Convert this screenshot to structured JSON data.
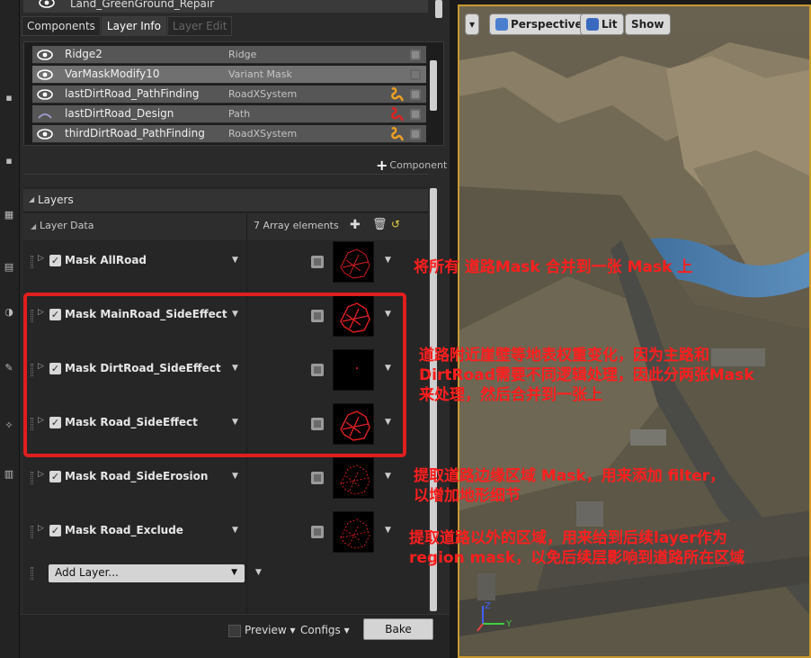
{
  "top_row": {
    "name": "Land_GreenGround_Repair"
  },
  "tabs": [
    {
      "label": "Components"
    },
    {
      "label": "Layer Info"
    },
    {
      "label": "Layer Edit"
    }
  ],
  "components": [
    {
      "name": "Ridge2",
      "type": "Ridge",
      "icon": "eye-icon"
    },
    {
      "name": "VarMaskModify10",
      "type": "Variant Mask",
      "icon": "eye-icon"
    },
    {
      "name": "lastDirtRoad_PathFinding",
      "type": "RoadXSystem",
      "icon": "eye-icon",
      "badge_color": "#f0a020"
    },
    {
      "name": "lastDirtRoad_Design",
      "type": "Path",
      "icon": "path-icon",
      "badge_color": "#e02020"
    },
    {
      "name": "thirdDirtRoad_PathFinding",
      "type": "RoadXSystem",
      "icon": "eye-icon",
      "badge_color": "#f0a020"
    }
  ],
  "add_component_label": "Component",
  "layers": {
    "section_title": "Layers",
    "subheader": "Layer Data",
    "count": "7 Array elements",
    "rows": [
      {
        "name": "Mask AllRoad"
      },
      {
        "name": "Mask MainRoad_SideEffect"
      },
      {
        "name": "Mask DirtRoad_SideEffect"
      },
      {
        "name": "Mask Road_SideEffect"
      },
      {
        "name": "Mask Road_SideErosion"
      },
      {
        "name": "Mask Road_Exclude"
      }
    ],
    "add_layer_label": "Add Layer..."
  },
  "bottom": {
    "preview_label": "Preview",
    "configs_label": "Configs",
    "bake_label": "Bake"
  },
  "viewport": {
    "perspective_label": "Perspective",
    "lit_label": "Lit",
    "show_label": "Show"
  },
  "annotations": {
    "a1": "将所有 道路Mask 合并到一张 Mask 上",
    "a2_l1": "道路附近崖壁等地表权重变化，因为主路和",
    "a2_l2": "DirtRoad需要不同逻辑处理，因此分两张Mask",
    "a2_l3": "来处理，然后合并到一张上",
    "a3_l1": "提取道路边缘区域 Mask，用来添加 filter，",
    "a3_l2": "以增加地形细节",
    "a4_l1": "提取道路以外的区域，用来给到后续layer作为",
    "a4_l2": "region mask，以免后续层影响到道路所在区域"
  },
  "colors": {
    "annotation_red": "#ff1e1e",
    "viewport_border": "#c99a2e",
    "red_box": "#e01e1e"
  }
}
